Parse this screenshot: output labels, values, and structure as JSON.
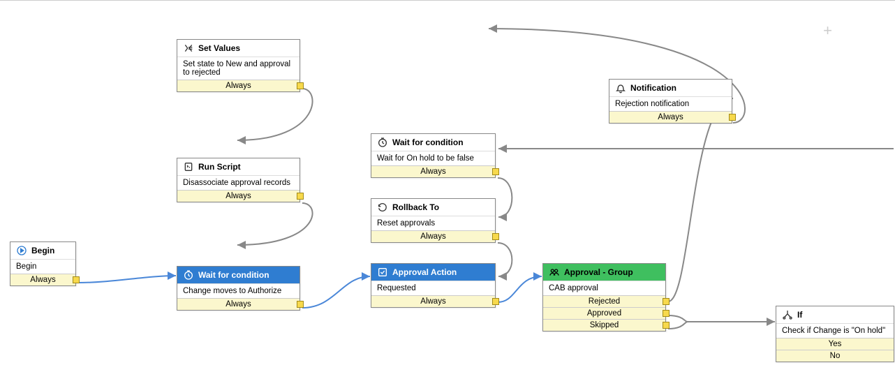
{
  "nodes": {
    "begin": {
      "title": "Begin",
      "body": "Begin",
      "cond": "Always"
    },
    "set_values": {
      "title": "Set Values",
      "body": "Set state to New and approval to rejected",
      "cond": "Always"
    },
    "run_script": {
      "title": "Run Script",
      "body": "Disassociate approval records",
      "cond": "Always"
    },
    "wait_authorize": {
      "title": "Wait for condition",
      "body": "Change moves to Authorize",
      "cond": "Always"
    },
    "wait_hold": {
      "title": "Wait for condition",
      "body": "Wait for On hold to be false",
      "cond": "Always"
    },
    "rollback": {
      "title": "Rollback To",
      "body": "Reset approvals",
      "cond": "Always"
    },
    "approval_action": {
      "title": "Approval Action",
      "body": "Requested",
      "cond": "Always"
    },
    "approval_group": {
      "title": "Approval - Group",
      "body": "CAB approval",
      "c1": "Rejected",
      "c2": "Approved",
      "c3": "Skipped"
    },
    "notification": {
      "title": "Notification",
      "body": "Rejection notification",
      "cond": "Always"
    },
    "if": {
      "title": "If",
      "body": "Check if Change is \"On hold\"",
      "c1": "Yes",
      "c2": "No"
    }
  }
}
